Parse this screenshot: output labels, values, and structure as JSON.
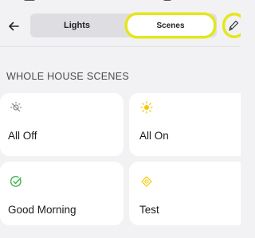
{
  "header": {
    "tabs": [
      {
        "label": "Lights",
        "selected": false
      },
      {
        "label": "Scenes",
        "selected": true
      }
    ]
  },
  "icons": {
    "back": "arrow-left-icon",
    "edit": "pencil-icon"
  },
  "colors": {
    "highlight": "#e4e61c",
    "accent_yellow": "#f7c600",
    "accent_green": "#3cb54a",
    "icon_gray": "#8a8a8a"
  },
  "section": {
    "title": "WHOLE HOUSE SCENES"
  },
  "scenes": [
    {
      "label": "All Off",
      "icon": "bulb-off-icon"
    },
    {
      "label": "All On",
      "icon": "sun-icon"
    },
    {
      "label": "Good Morning",
      "icon": "check-circle-icon"
    },
    {
      "label": "Test",
      "icon": "scene-diamond-icon"
    }
  ]
}
